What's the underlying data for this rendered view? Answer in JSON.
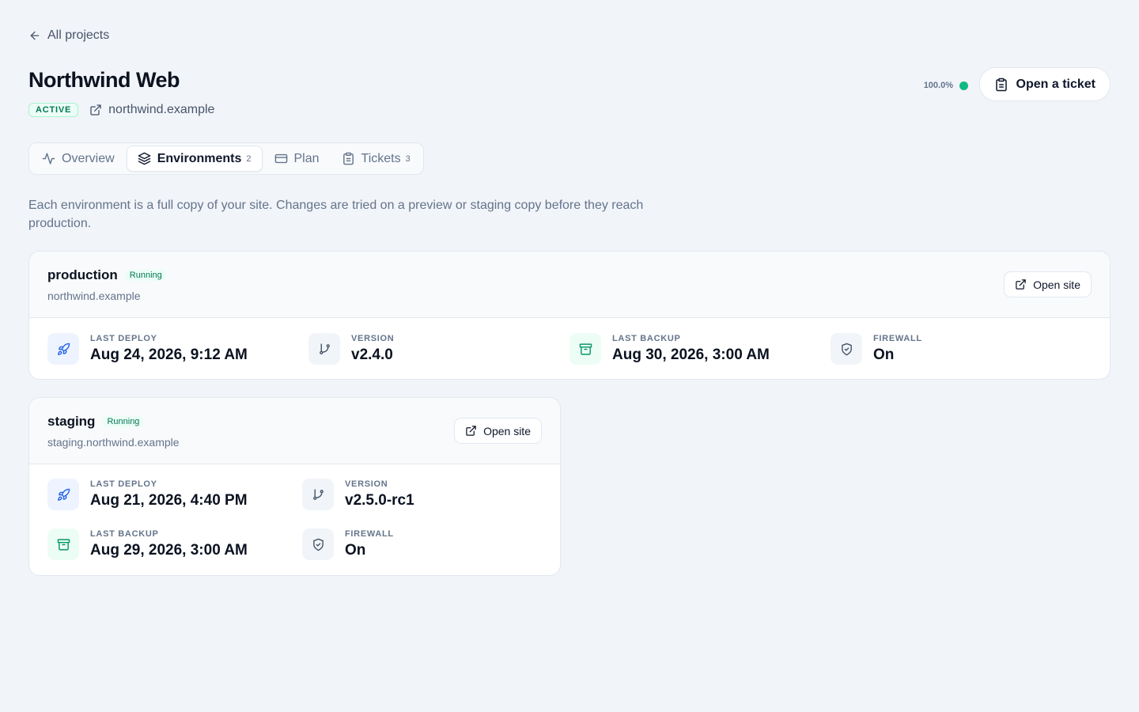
{
  "nav": {
    "back_label": "All projects"
  },
  "project": {
    "title": "Northwind Web",
    "status": "ACTIVE",
    "domain": "northwind.example",
    "uptime": "100.0%",
    "ticket_button": "Open a ticket"
  },
  "tabs": [
    {
      "label": "Overview",
      "count": "",
      "icon": "activity-icon"
    },
    {
      "label": "Environments",
      "count": "2",
      "icon": "layers-icon"
    },
    {
      "label": "Plan",
      "count": "",
      "icon": "credit-card-icon"
    },
    {
      "label": "Tickets",
      "count": "3",
      "icon": "clipboard-icon"
    }
  ],
  "intro": "Each environment is a full copy of your site. Changes are tried on a preview or staging copy before they reach production.",
  "environments": [
    {
      "name": "production",
      "status": "Running",
      "url": "northwind.example",
      "open_label": "Open site",
      "stats": [
        {
          "label": "LAST DEPLOY",
          "value": "Aug 24, 2026, 9:12 AM",
          "icon": "rocket-icon"
        },
        {
          "label": "VERSION",
          "value": "v2.4.0",
          "icon": "git-branch-icon"
        },
        {
          "label": "LAST BACKUP",
          "value": "Aug 30, 2026, 3:00 AM",
          "icon": "archive-icon"
        },
        {
          "label": "FIREWALL",
          "value": "On",
          "icon": "shield-check-icon"
        }
      ]
    },
    {
      "name": "staging",
      "status": "Running",
      "url": "staging.northwind.example",
      "open_label": "Open site",
      "stats": [
        {
          "label": "LAST DEPLOY",
          "value": "Aug 21, 2026, 4:40 PM",
          "icon": "rocket-icon"
        },
        {
          "label": "VERSION",
          "value": "v2.5.0-rc1",
          "icon": "git-branch-icon"
        },
        {
          "label": "LAST BACKUP",
          "value": "Aug 29, 2026, 3:00 AM",
          "icon": "archive-icon"
        },
        {
          "label": "FIREWALL",
          "value": "On",
          "icon": "shield-check-icon"
        }
      ]
    }
  ],
  "colors": {
    "accent_green": "#10b981",
    "accent_blue": "#2563eb",
    "background": "#f1f4f9"
  }
}
